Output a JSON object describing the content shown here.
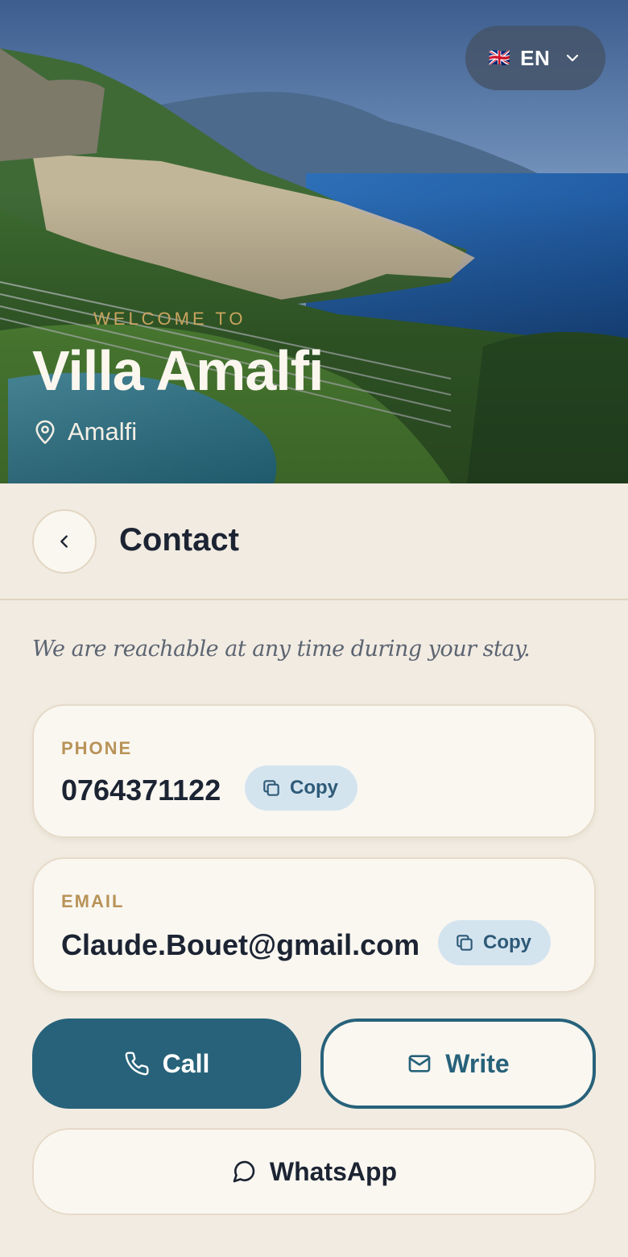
{
  "hero": {
    "language": {
      "flag": "🇬🇧",
      "code": "EN"
    },
    "welcome": "WELCOME TO",
    "title": "Villa Amalfi",
    "location": "Amalfi"
  },
  "header": {
    "title": "Contact"
  },
  "intro": "We are reachable at any time during your stay.",
  "phone": {
    "label": "PHONE",
    "value": "0764371122",
    "copy_label": "Copy"
  },
  "email": {
    "label": "EMAIL",
    "value": "Claude.Bouet@gmail.com",
    "copy_label": "Copy"
  },
  "actions": {
    "call": "Call",
    "write": "Write",
    "whatsapp": "WhatsApp"
  },
  "colors": {
    "accent": "#27627a",
    "gold": "#b89358",
    "background": "#f1ebe1",
    "copy_bg": "#d4e4ef"
  },
  "icons": {
    "language": "chevron-down-icon",
    "location": "map-pin-icon",
    "back": "chevron-left-icon",
    "copy": "copy-icon",
    "call": "phone-icon",
    "write": "mail-icon",
    "whatsapp": "chat-bubble-icon"
  }
}
